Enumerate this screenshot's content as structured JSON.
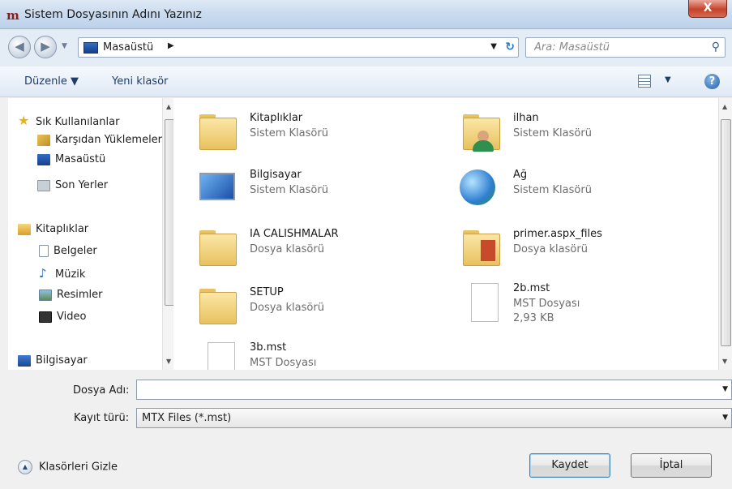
{
  "window": {
    "title": "Sistem Dosyasının Adını Yazınız",
    "close_glyph": "X"
  },
  "nav": {
    "back_glyph": "◀",
    "forward_glyph": "▶",
    "address_path": "Masaüstü",
    "search_placeholder": "Ara: Masaüstü"
  },
  "toolbar": {
    "organize": "Düzenle ▼",
    "new_folder": "Yeni klasör",
    "help_glyph": "?"
  },
  "sidebar": {
    "favorites": [
      {
        "label": "Sık Kullanılanlar",
        "icon": "star-icon"
      },
      {
        "label": "Karşıdan Yüklemeler",
        "icon": "downloads-icon"
      },
      {
        "label": "Masaüstü",
        "icon": "desktop-icon"
      },
      {
        "label": "Son Yerler",
        "icon": "recent-places-icon"
      }
    ],
    "libraries": [
      {
        "label": "Kitaplıklar",
        "icon": "libraries-icon"
      },
      {
        "label": "Belgeler",
        "icon": "documents-icon"
      },
      {
        "label": "Müzik",
        "icon": "music-icon"
      },
      {
        "label": "Resimler",
        "icon": "pictures-icon"
      },
      {
        "label": "Video",
        "icon": "video-icon"
      }
    ],
    "computer": {
      "label": "Bilgisayar",
      "icon": "computer-icon"
    }
  },
  "files": [
    {
      "name": "Kitaplıklar",
      "type": "Sistem Klasörü",
      "icon": "libraries-folder-icon"
    },
    {
      "name": "ilhan",
      "type": "Sistem Klasörü",
      "icon": "user-folder-icon"
    },
    {
      "name": "Bilgisayar",
      "type": "Sistem Klasörü",
      "icon": "computer-icon"
    },
    {
      "name": "Ağ",
      "type": "Sistem Klasörü",
      "icon": "network-icon"
    },
    {
      "name": "IA CALISHMALAR",
      "type": "Dosya klasörü",
      "icon": "folder-icon"
    },
    {
      "name": "primer.aspx_files",
      "type": "Dosya klasörü",
      "icon": "folder-icon"
    },
    {
      "name": "SETUP",
      "type": "Dosya klasörü",
      "icon": "folder-icon"
    },
    {
      "name": "2b.mst",
      "type": "MST Dosyası",
      "size": "2,93 KB",
      "icon": "file-icon"
    },
    {
      "name": "3b.mst",
      "type": "MST Dosyası",
      "icon": "file-icon"
    }
  ],
  "form": {
    "filename_label": "Dosya Adı:",
    "filename_value": "",
    "filetype_label": "Kayıt türü:",
    "filetype_value": "MTX Files (*.mst)"
  },
  "footer": {
    "hide_folders": "Klasörleri Gizle",
    "save": "Kaydet",
    "cancel": "İptal"
  }
}
